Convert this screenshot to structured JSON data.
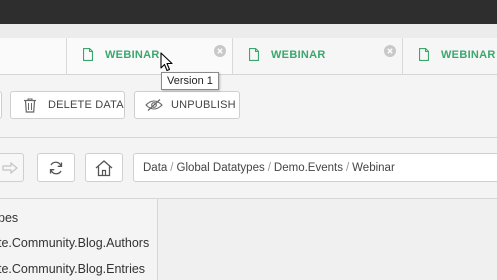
{
  "tabs": [
    {
      "label": ""
    },
    {
      "label": "WEBINAR"
    },
    {
      "label": "WEBINAR"
    },
    {
      "label": "WEBINAR"
    }
  ],
  "tooltip": "Version 1",
  "toolbar": {
    "delete_label": "DELETE DATA",
    "unpublish_label": "UNPUBLISH"
  },
  "breadcrumb": [
    "Data",
    "Global Datatypes",
    "Demo.Events",
    "Webinar"
  ],
  "sidebar": {
    "items": [
      {
        "label": "pes"
      },
      {
        "label": "te.Community.Blog.Authors"
      },
      {
        "label": "te.Community.Blog.Entries"
      }
    ]
  },
  "colors": {
    "accent": "#3aa76d",
    "topbar": "#2e2e2e"
  },
  "icons": {
    "tab": "document-icon",
    "close": "close-circle-icon",
    "delete": "trash-icon",
    "unpublish": "eye-slash-icon",
    "back": "arrow-right-icon",
    "refresh": "refresh-icon",
    "home": "home-icon"
  }
}
